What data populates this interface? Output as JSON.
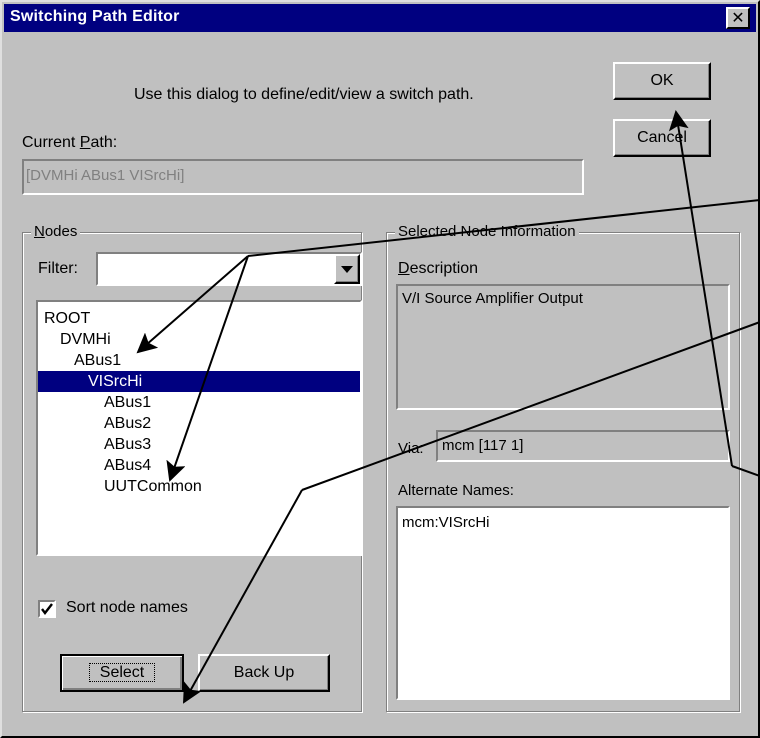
{
  "window": {
    "title": "Switching Path Editor",
    "close_glyph": "✕"
  },
  "intro_text": "Use this dialog to define/edit/view a switch path.",
  "buttons": {
    "ok": "OK",
    "cancel": "Cancel",
    "select": "Select",
    "back_up": "Back Up"
  },
  "current_path": {
    "label_prefix": "Current ",
    "label_u": "P",
    "label_rest": "ath:",
    "value": "[DVMHi ABus1 VISrcHi]"
  },
  "nodes": {
    "title_u": "N",
    "title_rest": "odes",
    "filter_label": "Filter:",
    "filter_value": "",
    "tree": [
      {
        "label": "ROOT",
        "level": 0,
        "selected": false
      },
      {
        "label": "DVMHi",
        "level": 1,
        "selected": false
      },
      {
        "label": "ABus1",
        "level": 2,
        "selected": false
      },
      {
        "label": "VISrcHi",
        "level": 3,
        "selected": true
      },
      {
        "label": "ABus1",
        "level": 4,
        "selected": false
      },
      {
        "label": "ABus2",
        "level": 4,
        "selected": false
      },
      {
        "label": "ABus3",
        "level": 4,
        "selected": false
      },
      {
        "label": "ABus4",
        "level": 4,
        "selected": false
      },
      {
        "label": "UUTCommon",
        "level": 4,
        "selected": false
      }
    ],
    "sort_label": "Sort node names",
    "sort_checked": true
  },
  "node_info": {
    "title": "Selected Node Information",
    "description_label_u": "D",
    "description_label_rest": "escription",
    "description_value": "V/I Source Amplifier Output",
    "via_label": "Via:",
    "via_value": "mcm [117 1]",
    "alternate_label": "Alternate Names:",
    "alternate_value": "mcm:VISrcHi"
  },
  "colors": {
    "title_bar": "#000080",
    "dialog_face": "#c0c0c0",
    "selection": "#000080"
  }
}
